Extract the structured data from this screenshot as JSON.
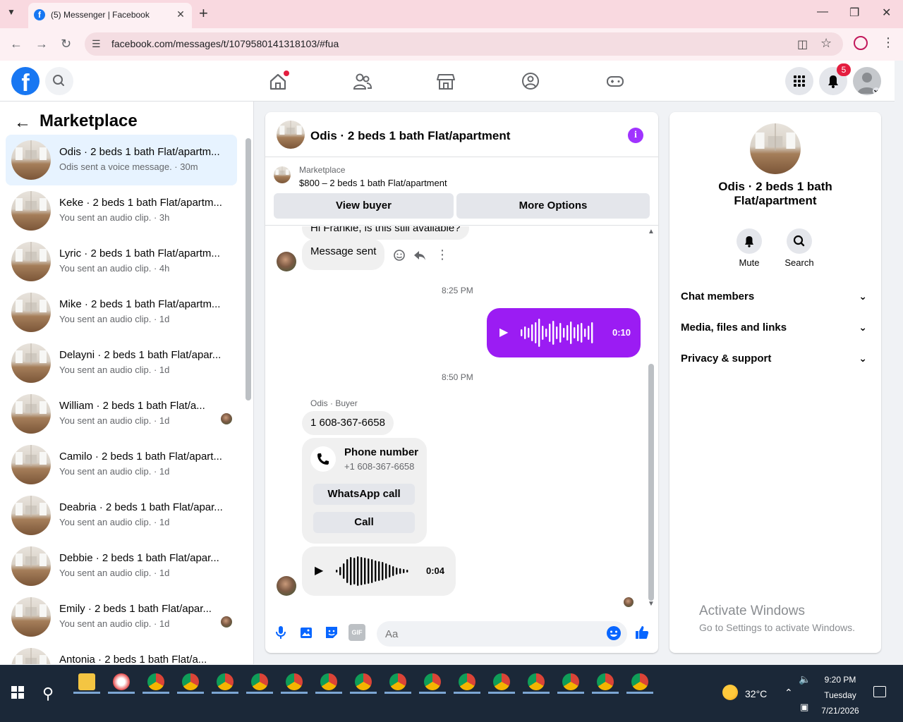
{
  "browser": {
    "tab_title": "(5) Messenger | Facebook",
    "tab_favicon": "f",
    "url": "facebook.com/messages/t/1079580141318103/#fua"
  },
  "header": {
    "notification_count": "5",
    "brand_color": "#1877f2"
  },
  "sidebar": {
    "title": "Marketplace",
    "conversations": [
      {
        "name": "Odis · 2 beds 1 bath Flat/apartm...",
        "sub": "Odis sent a voice message. · 30m",
        "active": true
      },
      {
        "name": "Keke · 2 beds 1 bath Flat/apartm...",
        "sub": "You sent an audio clip. · 3h"
      },
      {
        "name": "Lyric · 2 beds 1 bath Flat/apartm...",
        "sub": "You sent an audio clip. · 4h"
      },
      {
        "name": "Mike · 2 beds 1 bath Flat/apartm...",
        "sub": "You sent an audio clip. · 1d"
      },
      {
        "name": "Delayni · 2 beds 1 bath Flat/apar...",
        "sub": "You sent an audio clip. · 1d"
      },
      {
        "name": "William · 2 beds 1 bath Flat/a...",
        "sub": "You sent an audio clip. · 1d",
        "seen": true
      },
      {
        "name": "Camilo · 2 beds 1 bath Flat/apart...",
        "sub": "You sent an audio clip. · 1d"
      },
      {
        "name": "Deabria · 2 beds 1 bath Flat/apar...",
        "sub": "You sent an audio clip. · 1d"
      },
      {
        "name": "Debbie · 2 beds 1 bath Flat/apar...",
        "sub": "You sent an audio clip. · 1d"
      },
      {
        "name": "Emily · 2 beds 1 bath Flat/apar...",
        "sub": "You sent an audio clip. · 1d",
        "seen": true
      },
      {
        "name": "Antonia · 2 beds 1 bath Flat/a...",
        "sub": ""
      }
    ]
  },
  "chat": {
    "title": "Odis · 2 beds 1 bath Flat/apartment",
    "listing_source": "Marketplace",
    "listing_desc": "$800 – 2 beds 1 bath Flat/apartment",
    "view_buyer": "View buyer",
    "more_options": "More Options",
    "partial_message": "Hi Frankie, is this still available?",
    "message_sent": "Message sent",
    "time1": "8:25 PM",
    "outgoing_audio_duration": "0:10",
    "time2": "8:50 PM",
    "sender_label": "Odis · Buyer",
    "phone_text": "1 608-367-6658",
    "phone_card_title": "Phone number",
    "phone_card_number": "+1 608-367-6658",
    "whatsapp_call": "WhatsApp call",
    "call": "Call",
    "incoming_audio_duration": "0:04",
    "input_placeholder": "Aa",
    "accent_color": "#a033ff",
    "outgoing_bubble_color": "#9b1cf3"
  },
  "info_panel": {
    "name": "Odis · 2 beds 1 bath Flat/apartment",
    "mute": "Mute",
    "search": "Search",
    "sections": [
      "Chat members",
      "Media, files and links",
      "Privacy & support"
    ]
  },
  "watermark": {
    "title": "Activate Windows",
    "sub": "Go to Settings to activate Windows."
  },
  "taskbar": {
    "temperature": "32°C",
    "time": "9:20 PM",
    "day": "Tuesday",
    "date": "7/21/2026"
  }
}
